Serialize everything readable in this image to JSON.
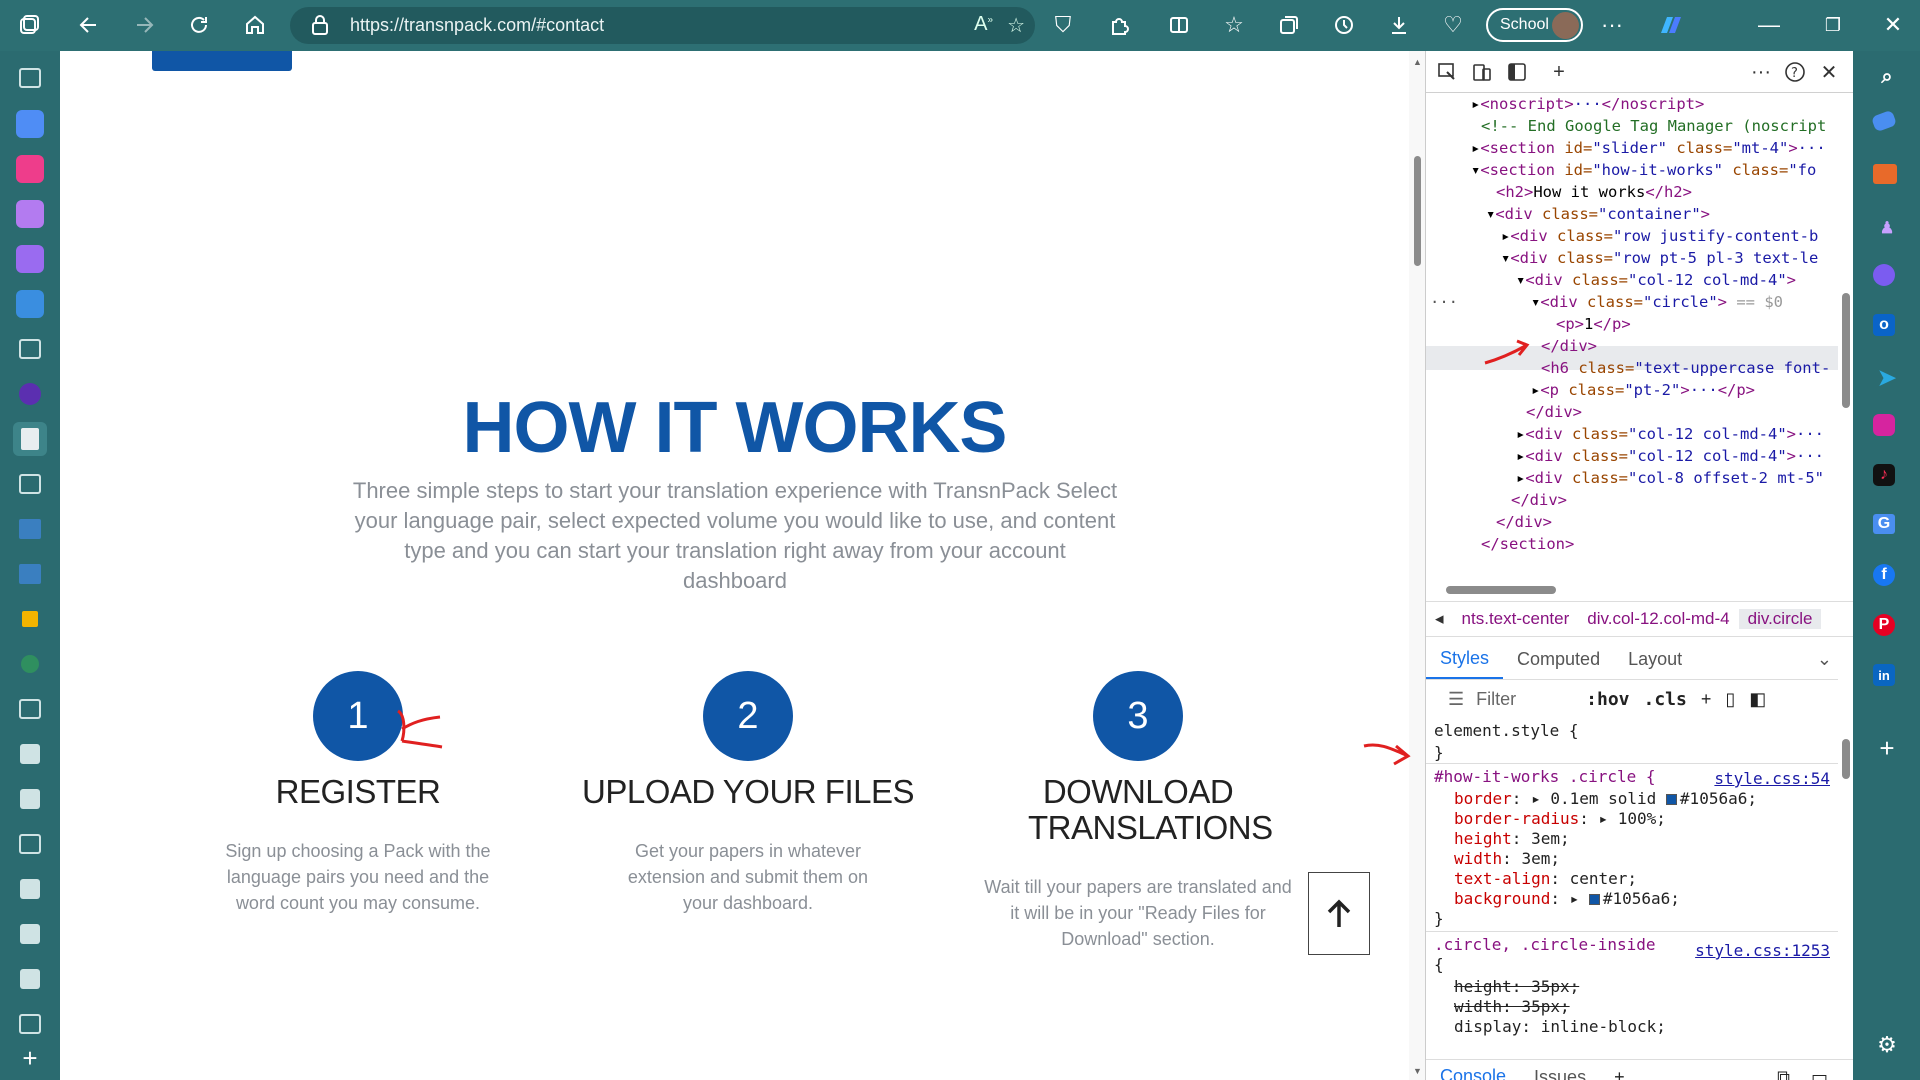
{
  "browser": {
    "url": "https://transnpack.com/#contact",
    "profile_label": "School"
  },
  "page": {
    "title": "HOW IT WORKS",
    "subtitle": "Three simple steps to start your translation experience with TransnPack Select your language pair, select expected volume you would like to use, and content type and you can start your translation right away from your account dashboard",
    "steps": [
      {
        "number": "1",
        "title": "REGISTER",
        "text": "Sign up choosing a Pack with the language pairs you need and the word count you may consume."
      },
      {
        "number": "2",
        "title": "UPLOAD YOUR FILES",
        "text": "Get your papers in whatever extension and submit them on your dashboard."
      },
      {
        "number": "3",
        "title": "DOWNLOAD TRANSLATIONS",
        "text": "Wait till your papers are translated and it will be in your \"Ready Files for Download\" section."
      }
    ],
    "scroll_top_icon": "arrow-up-icon"
  },
  "devtools": {
    "crumbs": [
      "nts.text-center",
      "div.col-12.col-md-4",
      "div.circle"
    ],
    "style_tabs": [
      "Styles",
      "Computed",
      "Layout"
    ],
    "filter_placeholder": "Filter",
    "filter_buttons": [
      ":hov",
      ".cls"
    ],
    "bottom_tabs": [
      "Console",
      "Issues"
    ],
    "rule1_selector": "#how-it-works .circle {",
    "rule1_link": "style.css:54",
    "rule2_selector": ".circle, .circle-inside",
    "rule2_link": "style.css:1253",
    "element_style": "element.style {"
  },
  "colors": {
    "accent": "#1056a6",
    "frame": "#2b6b70"
  }
}
